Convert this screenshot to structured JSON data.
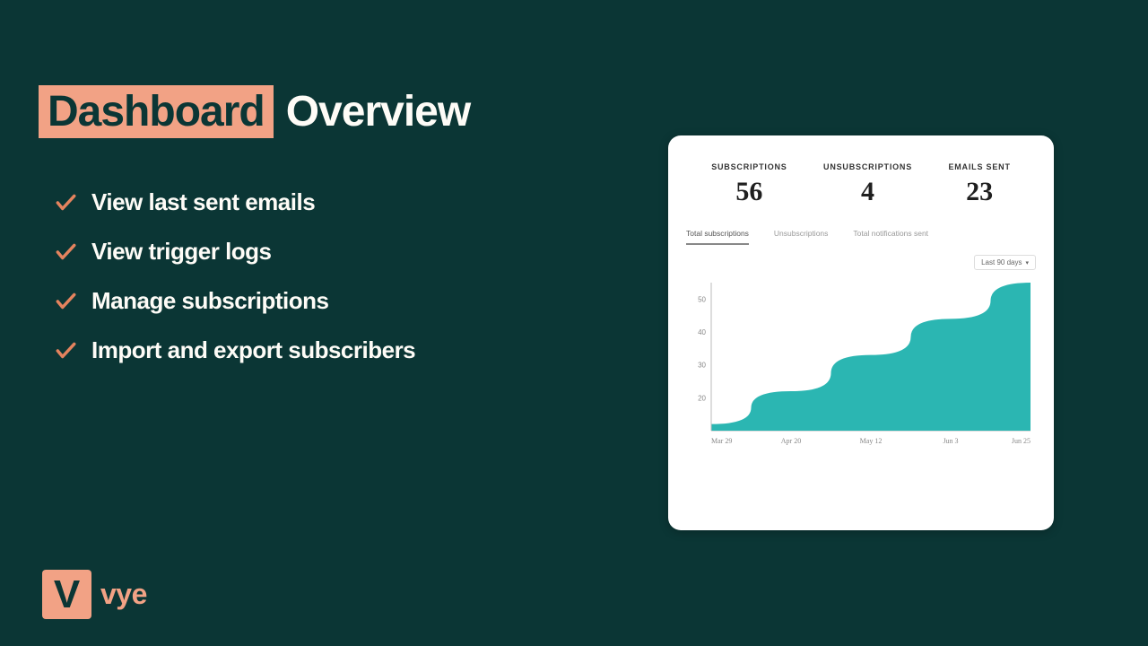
{
  "title": {
    "highlight": "Dashboard",
    "rest": "Overview"
  },
  "bullets": [
    "View last sent emails",
    "View trigger logs",
    "Manage subscriptions",
    "Import and export subscribers"
  ],
  "logo": {
    "badge": "V",
    "text": "vye"
  },
  "colors": {
    "bg": "#0b3635",
    "accent": "#f2a285",
    "chartFill": "#2bb6b2"
  },
  "card": {
    "metrics": [
      {
        "label": "SUBSCRIPTIONS",
        "value": "56"
      },
      {
        "label": "UNSUBSCRIPTIONS",
        "value": "4"
      },
      {
        "label": "EMAILS SENT",
        "value": "23"
      }
    ],
    "tabs": [
      {
        "label": "Total subscriptions",
        "active": true
      },
      {
        "label": "Unsubscriptions",
        "active": false
      },
      {
        "label": "Total notifications sent",
        "active": false
      }
    ],
    "range": "Last 90 days"
  },
  "chart_data": {
    "type": "area",
    "title": "",
    "xlabel": "",
    "ylabel": "",
    "ylim": [
      10,
      55
    ],
    "yticks": [
      20,
      30,
      40,
      50
    ],
    "x": [
      "Mar 29",
      "Apr 20",
      "May 12",
      "Jun 3",
      "Jun 25"
    ],
    "values": [
      12,
      22,
      33,
      44,
      55
    ]
  }
}
